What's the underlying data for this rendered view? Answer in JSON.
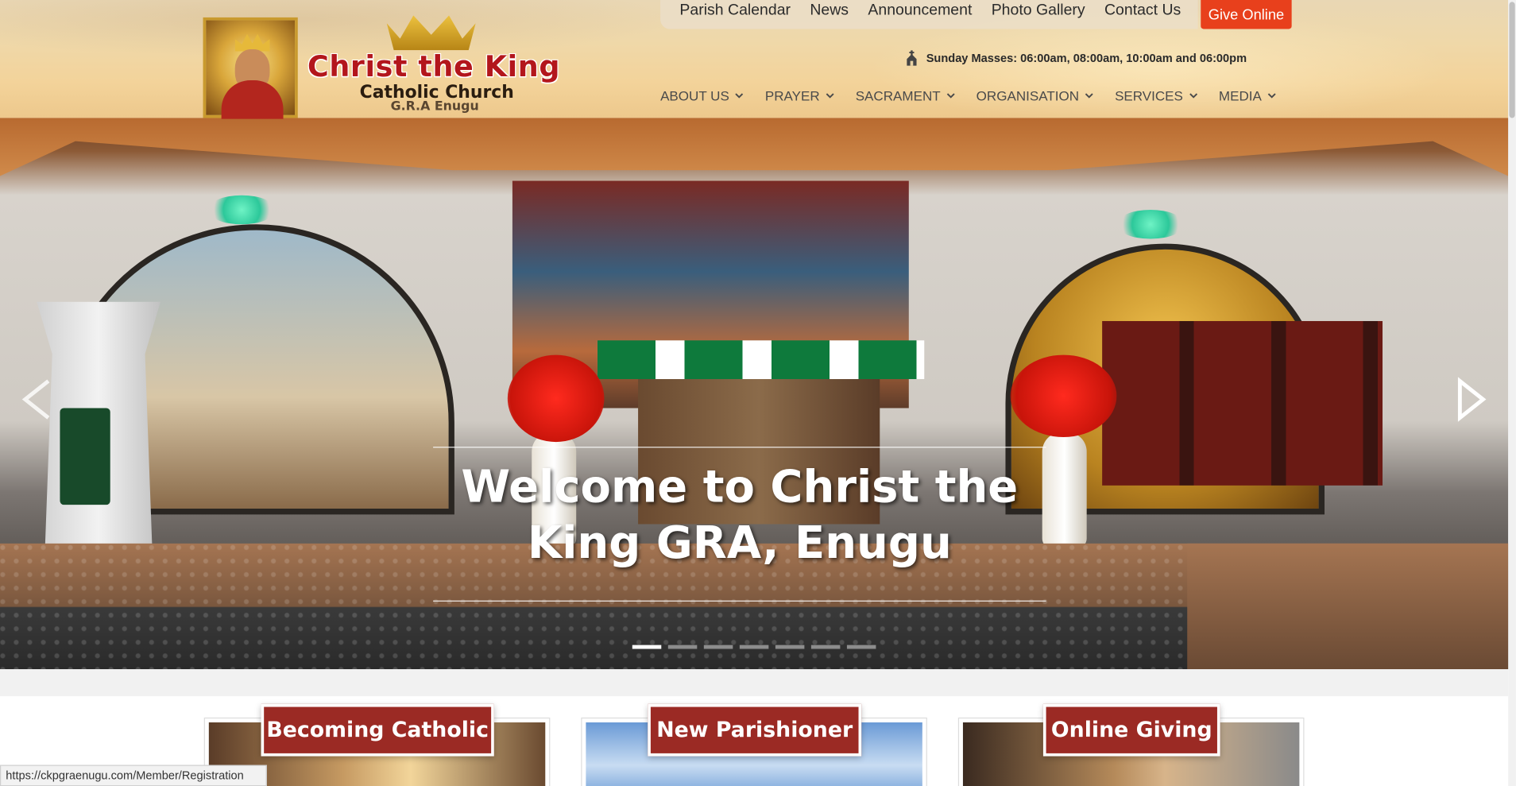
{
  "logo": {
    "title": "Christ the King",
    "subtitle": "Catholic Church",
    "location": "G.R.A Enugu"
  },
  "top_links": [
    "Parish Calendar",
    "News",
    "Announcement",
    "Photo Gallery",
    "Contact Us"
  ],
  "give_button": "Give Online",
  "mass_info": "Sunday Masses: 06:00am, 08:00am, 10:00am and 06:00pm",
  "main_nav": [
    "ABOUT US",
    "PRAYER",
    "SACRAMENT",
    "ORGANISATION",
    "SERVICES",
    "MEDIA"
  ],
  "hero": {
    "title_line1": "Welcome to Christ the",
    "title_line2": "King GRA, Enugu",
    "slide_count": 7,
    "active_slide": 1
  },
  "cards": [
    "Becoming Catholic",
    "New Parishioner",
    "Online Giving"
  ],
  "status_url": "https://ckpgraenugu.com/Member/Registration",
  "colors": {
    "accent": "#e8401c",
    "card_tag": "#9b2a24",
    "logo_red": "#b3161c"
  }
}
